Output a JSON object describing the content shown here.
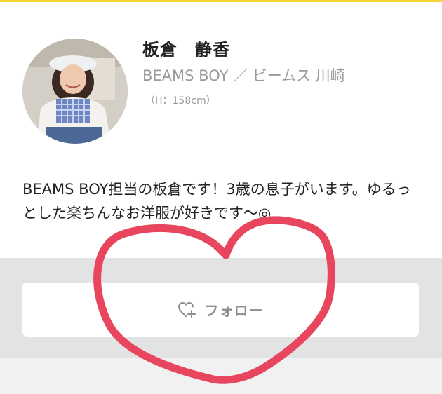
{
  "profile": {
    "name": "板倉　静香",
    "shop": "BEAMS BOY ／ ビームス 川崎",
    "height": "（H：158cm）",
    "bio": "BEAMS BOY担当の板倉です！3歳の息子がいます。ゆるっとした楽ちんなお洋服が好きです〜◎"
  },
  "follow_button": {
    "label": "フォロー",
    "icon": "heart-plus-icon"
  },
  "colors": {
    "accent": "#f4d531",
    "scribble": "#e8465f",
    "follow_area": "#e3e3e3"
  }
}
